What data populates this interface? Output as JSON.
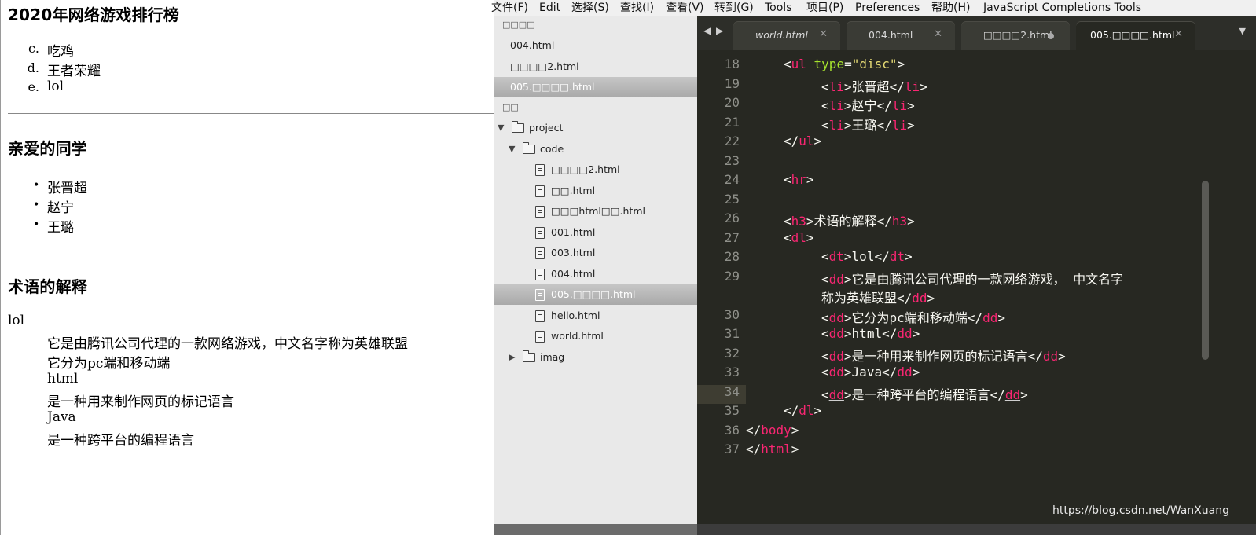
{
  "page": {
    "heading1": "2020年网络游戏排行榜",
    "ranking": [
      {
        "marker": "c.",
        "text": "吃鸡"
      },
      {
        "marker": "d.",
        "text": "王者荣耀"
      },
      {
        "marker": "e.",
        "text": "lol"
      }
    ],
    "heading2": "亲爱的同学",
    "classmates": [
      "张晋超",
      "赵宁",
      "王璐"
    ],
    "heading3": "术语的解释",
    "terms": [
      {
        "kind": "dt",
        "text": "lol"
      },
      {
        "kind": "dd",
        "text": "它是由腾讯公司代理的一款网络游戏，中文名字称为英雄联盟"
      },
      {
        "kind": "dd",
        "text": "它分为pc端和移动端"
      },
      {
        "kind": "dd",
        "text": "html"
      },
      {
        "kind": "dd",
        "text": "是一种用来制作网页的标记语言"
      },
      {
        "kind": "dd",
        "text": "Java"
      },
      {
        "kind": "dd",
        "text": "是一种跨平台的编程语言"
      }
    ]
  },
  "editor": {
    "menu": [
      "文件(F)",
      "Edit",
      "选择(S)",
      "查找(I)",
      "查看(V)",
      "转到(G)",
      "Tools",
      "项目(P)",
      "Preferences",
      "帮助(H)",
      "JavaScript Completions Tools"
    ],
    "sidebar": {
      "open_files_header": "□□□□",
      "open_files": [
        "004.html",
        "□□□□2.html",
        "005.□□□□.html"
      ],
      "folders_header": "□□",
      "tree": [
        {
          "label": "project",
          "type": "folder",
          "expanded": true
        },
        {
          "label": "code",
          "type": "folder",
          "expanded": true
        },
        {
          "label": "□□□□2.html",
          "type": "file"
        },
        {
          "label": "□□.html",
          "type": "file"
        },
        {
          "label": "□□□html□□.html",
          "type": "file"
        },
        {
          "label": "001.html",
          "type": "file"
        },
        {
          "label": "003.html",
          "type": "file"
        },
        {
          "label": "004.html",
          "type": "file"
        },
        {
          "label": "005.□□□□.html",
          "type": "file",
          "selected": true
        },
        {
          "label": "hello.html",
          "type": "file"
        },
        {
          "label": "world.html",
          "type": "file"
        },
        {
          "label": "imag",
          "type": "folder",
          "expanded": false
        }
      ]
    },
    "tabs": [
      {
        "label": "world.html",
        "italic": true
      },
      {
        "label": "004.html"
      },
      {
        "label": "□□□□2.html",
        "dirty": true
      },
      {
        "label": "005.□□□□.html",
        "active": true
      }
    ],
    "line_numbers": [
      "18",
      "19",
      "20",
      "21",
      "22",
      "23",
      "24",
      "25",
      "26",
      "27",
      "28",
      "29",
      "",
      "30",
      "31",
      "32",
      "33",
      "34",
      "35",
      "36",
      "37"
    ],
    "code": {
      "l18_pre": "    <",
      "l18_tag": "ul",
      "l18_attr": " type",
      "l18_eq": "=",
      "l18_str": "\"disc\"",
      "l18_end": ">",
      "l19_open": "li",
      "l19_text": "张晋超",
      "l20_open": "li",
      "l20_text": "赵宁",
      "l21_open": "li",
      "l21_text": "王璐",
      "l22_tag": "ul",
      "l24_tag": "hr",
      "l26_tag": "h3",
      "l26_text": "术语的解释",
      "l27_tag": "dl",
      "l28_tag": "dt",
      "l28_text": "lol",
      "l29_tag": "dd",
      "l29_text": "它是由腾讯公司代理的一款网络游戏， 中文名字",
      "l29b_text": "称为英雄联盟",
      "l30_tag": "dd",
      "l30_text": "它分为pc端和移动端",
      "l31_tag": "dd",
      "l31_text": "html",
      "l32_tag": "dd",
      "l32_text": "是一种用来制作网页的标记语言",
      "l33_tag": "dd",
      "l33_text": "Java",
      "l34_tag": "dd",
      "l34_text": "是一种跨平台的编程语言",
      "l35_tag": "dl",
      "l36_tag": "body",
      "l37_tag": "html"
    },
    "watermark": "https://blog.csdn.net/WanXuang"
  }
}
